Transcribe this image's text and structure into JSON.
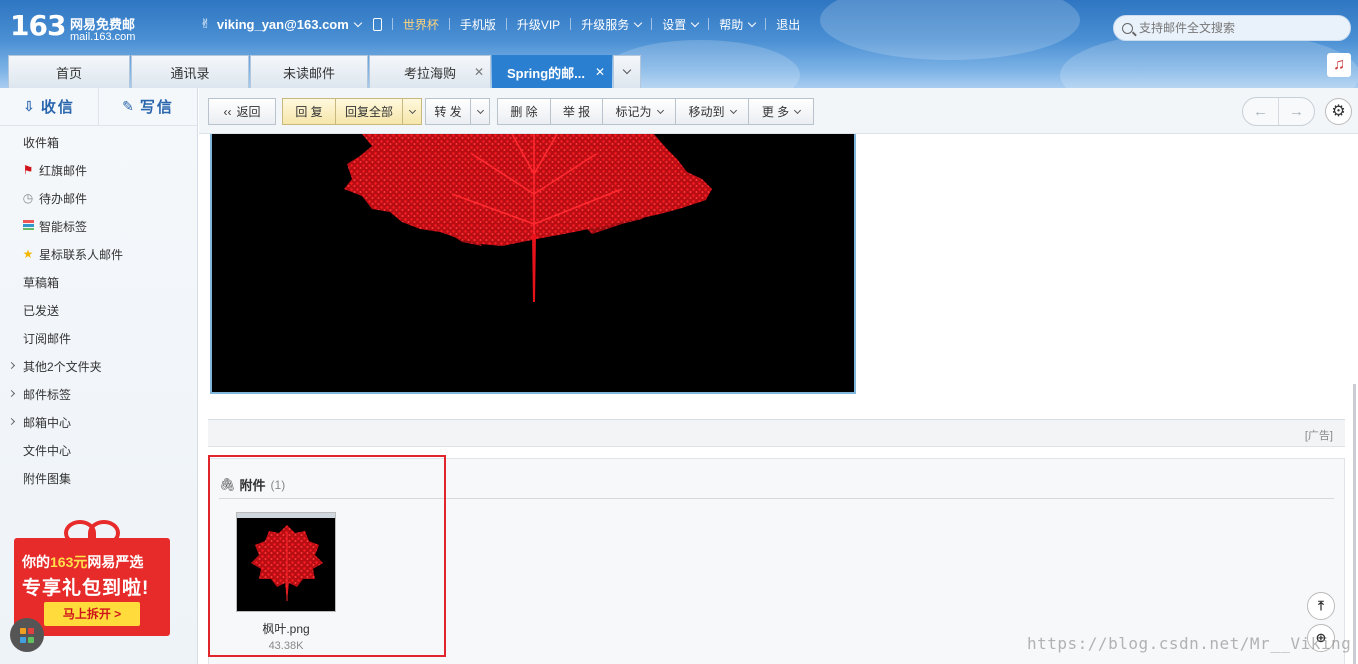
{
  "brand": {
    "number": "163",
    "name": "网易免费邮",
    "url": "mail.163.com"
  },
  "topnav": {
    "user": "viking_yan@163.com",
    "items": [
      "世界杯",
      "手机版",
      "升级VIP",
      "升级服务",
      "设置",
      "帮助",
      "退出"
    ]
  },
  "search": {
    "placeholder": "支持邮件全文搜索"
  },
  "tabs": [
    "首页",
    "通讯录",
    "未读邮件",
    "考拉海购",
    "Spring的邮..."
  ],
  "compose": {
    "receive": "收信",
    "write": "写信"
  },
  "folders": [
    {
      "label": "收件箱",
      "icon": ""
    },
    {
      "label": "红旗邮件",
      "icon": "flag-icon"
    },
    {
      "label": "待办邮件",
      "icon": "clock-icon"
    },
    {
      "label": "智能标签",
      "icon": "tag-icon"
    },
    {
      "label": "星标联系人邮件",
      "icon": "star-icon"
    },
    {
      "label": "草稿箱",
      "icon": ""
    },
    {
      "label": "已发送",
      "icon": ""
    },
    {
      "label": "订阅邮件",
      "icon": ""
    },
    {
      "label": "其他2个文件夹",
      "icon": "expand-arrow-icon"
    },
    {
      "label": "邮件标签",
      "icon": "expand-arrow-icon"
    },
    {
      "label": "邮箱中心",
      "icon": "expand-arrow-icon"
    },
    {
      "label": "文件中心",
      "icon": ""
    },
    {
      "label": "附件图集",
      "icon": ""
    }
  ],
  "promo": {
    "line1_pre": "你的",
    "line1_amount": "163元",
    "line1_post": "网易严选",
    "line2": "专享礼包到啦!",
    "button": "马上拆开 >"
  },
  "toolbar": {
    "back": "返回",
    "reply": "回 复",
    "reply_all": "回复全部",
    "forward": "转 发",
    "delete": "删 除",
    "report": "举 报",
    "mark": "标记为",
    "move": "移动到",
    "more": "更 多"
  },
  "ad_label": "[广告]",
  "attachments": {
    "title": "附件",
    "count": "(1)",
    "file_name": "枫叶.png",
    "file_size": "43.38K"
  },
  "watermark": "https://blog.csdn.net/Mr__Viking",
  "colors": {
    "header_blue": "#3a82cc",
    "active_tab": "#2a7fd0",
    "highlight_box": "#e0262c",
    "leaf_red": "#e8121a"
  }
}
